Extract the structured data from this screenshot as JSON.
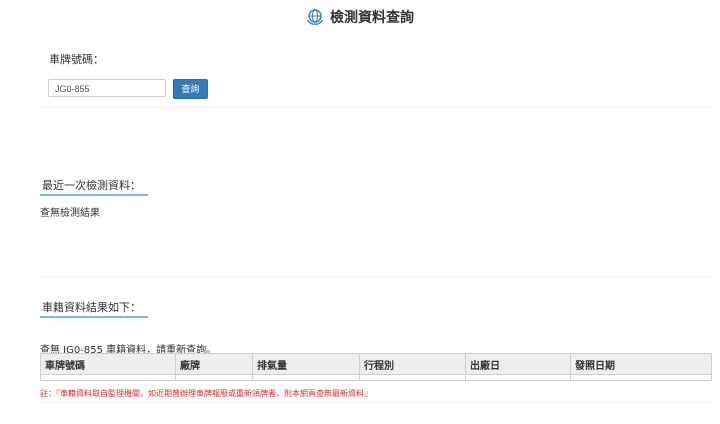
{
  "header": {
    "title": "檢測資料查詢",
    "icon": "globe-hands-icon"
  },
  "search": {
    "label": "車牌號碼：",
    "plate_value": "JG0-855",
    "button_label": "查詢"
  },
  "latest_inspection": {
    "heading": "最近一次檢測資料：",
    "result_text": "查無檢測結果"
  },
  "vehicle_registry": {
    "heading": "車籍資料結果如下：",
    "message": "查無 JG0-855 車籍資料，請重新查詢。",
    "columns": [
      "車牌號碼",
      "廠牌",
      "排氣量",
      "行程別",
      "出廠日",
      "發照日期"
    ],
    "rows": []
  },
  "note": "註：『車籍資料取自監理機關，如近期曾辦理車牌報廢或重新領牌者，則本網頁查無最新資料』",
  "colors": {
    "accent": "#337ab7",
    "underline": "#7fb6e0",
    "note_red": "#d9302c"
  }
}
